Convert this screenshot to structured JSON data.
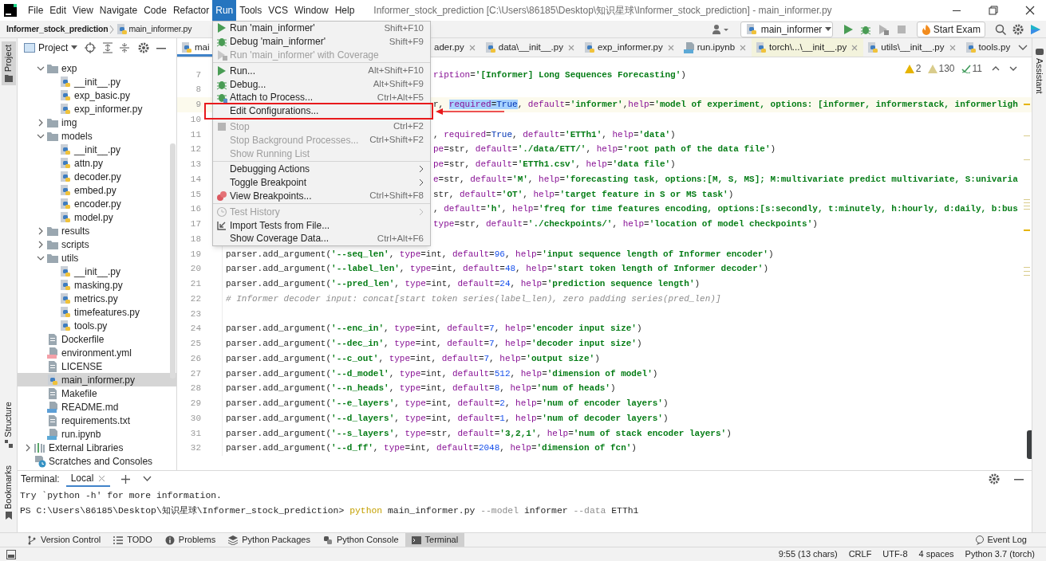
{
  "window": {
    "title": "Informer_stock_prediction [C:\\Users\\86185\\Desktop\\知识星球\\Informer_stock_prediction] - main_informer.py"
  },
  "menu_bar": [
    {
      "label": "File",
      "selected": false
    },
    {
      "label": "Edit",
      "selected": false
    },
    {
      "label": "View",
      "selected": false
    },
    {
      "label": "Navigate",
      "selected": false
    },
    {
      "label": "Code",
      "selected": false
    },
    {
      "label": "Refactor",
      "selected": false
    },
    {
      "label": "Run",
      "selected": true
    },
    {
      "label": "Tools",
      "selected": false
    },
    {
      "label": "VCS",
      "selected": false
    },
    {
      "label": "Window",
      "selected": false
    },
    {
      "label": "Help",
      "selected": false
    }
  ],
  "breadcrumb": {
    "project": "Informer_stock_prediction",
    "file": "main_informer.py"
  },
  "toolbar": {
    "run_config": "main_informer",
    "exam_button": "Start Exam"
  },
  "side_tools": {
    "project": {
      "label": "Project",
      "selected": true
    },
    "structure": {
      "label": "Structure",
      "selected": false
    },
    "bookmarks": {
      "label": "Bookmarks",
      "selected": false
    },
    "assistant": {
      "label": "Assistant",
      "selected": false
    }
  },
  "project_panel": {
    "title": "Project",
    "project_contents": [
      {
        "label": "exp",
        "kind": "folder",
        "expanded": true,
        "selected": false,
        "children": [
          {
            "label": "__init__.py",
            "kind": "python",
            "selected": false
          },
          {
            "label": "exp_basic.py",
            "kind": "python",
            "selected": false
          },
          {
            "label": "exp_informer.py",
            "kind": "python",
            "selected": false
          }
        ]
      },
      {
        "label": "img",
        "kind": "folder",
        "expanded": false,
        "selected": false
      },
      {
        "label": "models",
        "kind": "folder",
        "expanded": true,
        "selected": false,
        "children": [
          {
            "label": "__init__.py",
            "kind": "python",
            "selected": false
          },
          {
            "label": "attn.py",
            "kind": "python",
            "selected": false
          },
          {
            "label": "decoder.py",
            "kind": "python",
            "selected": false
          },
          {
            "label": "embed.py",
            "kind": "python",
            "selected": false
          },
          {
            "label": "encoder.py",
            "kind": "python",
            "selected": false
          },
          {
            "label": "model.py",
            "kind": "python",
            "selected": false
          }
        ]
      },
      {
        "label": "results",
        "kind": "folder",
        "expanded": false,
        "selected": false
      },
      {
        "label": "scripts",
        "kind": "folder",
        "expanded": false,
        "selected": false
      },
      {
        "label": "utils",
        "kind": "folder",
        "expanded": true,
        "selected": false,
        "children": [
          {
            "label": "__init__.py",
            "kind": "python",
            "selected": false
          },
          {
            "label": "masking.py",
            "kind": "python",
            "selected": false
          },
          {
            "label": "metrics.py",
            "kind": "python",
            "selected": false
          },
          {
            "label": "timefeatures.py",
            "kind": "python",
            "selected": false
          },
          {
            "label": "tools.py",
            "kind": "python",
            "selected": false
          }
        ]
      },
      {
        "label": "Dockerfile",
        "kind": "file",
        "selected": false
      },
      {
        "label": "environment.yml",
        "kind": "yml",
        "selected": false
      },
      {
        "label": "LICENSE",
        "kind": "file",
        "selected": false
      },
      {
        "label": "main_informer.py",
        "kind": "python",
        "selected": true
      },
      {
        "label": "Makefile",
        "kind": "file",
        "selected": false
      },
      {
        "label": "README.md",
        "kind": "md",
        "selected": false
      },
      {
        "label": "requirements.txt",
        "kind": "file",
        "selected": false
      },
      {
        "label": "run.ipynb",
        "kind": "ipynb",
        "selected": false
      }
    ],
    "roots": [
      {
        "label": "External Libraries",
        "kind": "libraries",
        "expanded": false,
        "selected": false
      },
      {
        "label": "Scratches and Consoles",
        "kind": "scratches",
        "selected": false
      }
    ]
  },
  "editor": {
    "tabs": [
      {
        "label": "mai",
        "kind": "python",
        "selected": true,
        "closable": false,
        "external": false
      },
      {
        "label": "ader.py",
        "kind": "plain",
        "selected": false,
        "closable": true,
        "external": false
      },
      {
        "label": "data\\__init__.py",
        "kind": "python",
        "selected": false,
        "closable": true,
        "external": false
      },
      {
        "label": "exp_informer.py",
        "kind": "python",
        "selected": false,
        "closable": true,
        "external": false
      },
      {
        "label": "run.ipynb",
        "kind": "notebook",
        "selected": false,
        "closable": true,
        "external": false
      },
      {
        "label": "torch\\...\\__init__.py",
        "kind": "python",
        "selected": false,
        "closable": true,
        "external": true
      },
      {
        "label": "utils\\__init__.py",
        "kind": "python",
        "selected": false,
        "closable": true,
        "external": false
      },
      {
        "label": "tools.py",
        "kind": "python",
        "selected": false,
        "closable": false,
        "external": false
      }
    ],
    "inspections": {
      "warnings": "2",
      "weak_warnings": "130",
      "typos": "11"
    },
    "code_lines": [
      {
        "number": "7",
        "current": false,
        "parts": [
          {
            "text": "ription='[Informer] Long Sequences Forecasting')",
            "selected": false
          }
        ]
      },
      {
        "number": "8",
        "current": false
      },
      {
        "number": "9",
        "current": true,
        "parts": [
          {
            "text": "r, ",
            "selected": false
          },
          {
            "text": "required=True",
            "selected": true
          },
          {
            "text": ", default='informer',help='model of experiment, options: [informer, informerstack, informerligh",
            "selected": false
          }
        ]
      },
      {
        "number": "10",
        "current": false
      },
      {
        "number": "11",
        "current": false,
        "parts": [
          {
            "text": ", required=True, default='ETTh1', help='data')",
            "selected": false
          }
        ]
      },
      {
        "number": "12",
        "current": false,
        "parts": [
          {
            "text": "pe=str, default='./data/ETT/', help='root path of the data file')",
            "selected": false
          }
        ]
      },
      {
        "number": "13",
        "current": false,
        "parts": [
          {
            "text": "pe=str, default='ETTh1.csv', help='data file')",
            "selected": false
          }
        ]
      },
      {
        "number": "14",
        "current": false,
        "parts": [
          {
            "text": "e=str, default='M', help='forecasting task, options:[M, S, MS]; M:multivariate predict multivariate, S:univaria",
            "selected": false
          }
        ]
      },
      {
        "number": "15",
        "current": false,
        "parts": [
          {
            "text": "str, default='OT', help='target feature in S or MS task')",
            "selected": false
          }
        ]
      },
      {
        "number": "16",
        "current": false,
        "parts": [
          {
            "text": ", default='h', help='freq for time features encoding, options:[s:secondly, t:minutely, h:hourly, d:daily, b:bus",
            "selected": false
          }
        ]
      },
      {
        "number": "17",
        "current": false,
        "parts": [
          {
            "text": "type=str, default='./checkpoints/', help='location of model checkpoints')",
            "selected": false
          }
        ]
      },
      {
        "number": "18",
        "current": false
      },
      {
        "number": "19",
        "current": false,
        "parts": [
          {
            "text": "parser.add_argument('--seq_len', type=int, default=96, help='input sequence length of Informer encoder')",
            "selected": false
          }
        ]
      },
      {
        "number": "20",
        "current": false,
        "parts": [
          {
            "text": "parser.add_argument('--label_len', type=int, default=48, help='start token length of Informer decoder')",
            "selected": false
          }
        ]
      },
      {
        "number": "21",
        "current": false,
        "parts": [
          {
            "text": "parser.add_argument('--pred_len', type=int, default=24, help='prediction sequence length')",
            "selected": false
          }
        ]
      },
      {
        "number": "22",
        "current": false,
        "parts": [
          {
            "text": "# Informer decoder input: concat[start token series(label_len), zero padding series(pred_len)]",
            "selected": false
          }
        ]
      },
      {
        "number": "23",
        "current": false
      },
      {
        "number": "24",
        "current": false,
        "parts": [
          {
            "text": "parser.add_argument('--enc_in', type=int, default=7, help='encoder input size')",
            "selected": false
          }
        ]
      },
      {
        "number": "25",
        "current": false,
        "parts": [
          {
            "text": "parser.add_argument('--dec_in', type=int, default=7, help='decoder input size')",
            "selected": false
          }
        ]
      },
      {
        "number": "26",
        "current": false,
        "parts": [
          {
            "text": "parser.add_argument('--c_out', type=int, default=7, help='output size')",
            "selected": false
          }
        ]
      },
      {
        "number": "27",
        "current": false,
        "parts": [
          {
            "text": "parser.add_argument('--d_model', type=int, default=512, help='dimension of model')",
            "selected": false
          }
        ]
      },
      {
        "number": "28",
        "current": false,
        "parts": [
          {
            "text": "parser.add_argument('--n_heads', type=int, default=8, help='num of heads')",
            "selected": false
          }
        ]
      },
      {
        "number": "29",
        "current": false,
        "parts": [
          {
            "text": "parser.add_argument('--e_layers', type=int, default=2, help='num of encoder layers')",
            "selected": false
          }
        ]
      },
      {
        "number": "30",
        "current": false,
        "parts": [
          {
            "text": "parser.add_argument('--d_layers', type=int, default=1, help='num of decoder layers')",
            "selected": false
          }
        ]
      },
      {
        "number": "31",
        "current": false,
        "parts": [
          {
            "text": "parser.add_argument('--s_layers', type=str, default='3,2,1', help='num of stack encoder layers')",
            "selected": false
          }
        ]
      },
      {
        "number": "32",
        "current": false,
        "parts": [
          {
            "text": "parser.add_argument('--d_ff', type=int, default=2048, help='dimension of fcn')",
            "selected": false
          }
        ]
      }
    ]
  },
  "run_menu": {
    "items": [
      {
        "kind": "item",
        "label": "Run 'main_informer'",
        "shortcut": "Shift+F10",
        "disabled": false,
        "submenu": false,
        "annotated": false
      },
      {
        "kind": "item",
        "label": "Debug 'main_informer'",
        "shortcut": "Shift+F9",
        "disabled": false,
        "submenu": false,
        "annotated": false
      },
      {
        "kind": "item",
        "label": "Run 'main_informer' with Coverage",
        "disabled": true,
        "submenu": false,
        "annotated": false
      },
      {
        "kind": "separator"
      },
      {
        "kind": "item",
        "label": "Run...",
        "shortcut": "Alt+Shift+F10",
        "disabled": false,
        "submenu": false,
        "annotated": false
      },
      {
        "kind": "item",
        "label": "Debug...",
        "shortcut": "Alt+Shift+F9",
        "disabled": false,
        "submenu": false,
        "annotated": false
      },
      {
        "kind": "item",
        "label": "Attach to Process...",
        "shortcut": "Ctrl+Alt+F5",
        "disabled": false,
        "submenu": false,
        "annotated": false
      },
      {
        "kind": "item",
        "label": "Edit Configurations...",
        "disabled": false,
        "submenu": false,
        "annotated": true
      },
      {
        "kind": "separator"
      },
      {
        "kind": "item",
        "label": "Stop",
        "shortcut": "Ctrl+F2",
        "disabled": true,
        "submenu": false,
        "annotated": false
      },
      {
        "kind": "item",
        "label": "Stop Background Processes...",
        "shortcut": "Ctrl+Shift+F2",
        "disabled": true,
        "submenu": false,
        "annotated": false
      },
      {
        "kind": "item",
        "label": "Show Running List",
        "disabled": true,
        "submenu": false,
        "annotated": false
      },
      {
        "kind": "separator"
      },
      {
        "kind": "item",
        "label": "Debugging Actions",
        "disabled": false,
        "submenu": true,
        "annotated": false
      },
      {
        "kind": "item",
        "label": "Toggle Breakpoint",
        "disabled": false,
        "submenu": true,
        "annotated": false
      },
      {
        "kind": "item",
        "label": "View Breakpoints...",
        "shortcut": "Ctrl+Shift+F8",
        "disabled": false,
        "submenu": false,
        "annotated": false
      },
      {
        "kind": "separator"
      },
      {
        "kind": "item",
        "label": "Test History",
        "disabled": true,
        "submenu": true,
        "annotated": false
      },
      {
        "kind": "item",
        "label": "Import Tests from File...",
        "disabled": false,
        "submenu": false,
        "annotated": false
      },
      {
        "kind": "item",
        "label": "Show Coverage Data...",
        "shortcut": "Ctrl+Alt+F6",
        "disabled": false,
        "submenu": false,
        "annotated": false
      }
    ]
  },
  "terminal": {
    "title": "Terminal:",
    "tabs": [
      {
        "label": "Local",
        "selected": true
      }
    ],
    "lines": [
      {
        "parts": [
          {
            "kind": "output",
            "text": "Try `python -h' for more information."
          }
        ]
      },
      {
        "parts": [
          {
            "kind": "output",
            "text": "PS C:\\Users\\86185\\Desktop\\知识星球\\Informer_stock_prediction> "
          },
          {
            "kind": "command",
            "text": "python"
          },
          {
            "kind": "output",
            "text": " main_informer.py "
          },
          {
            "kind": "option",
            "text": "--model"
          },
          {
            "kind": "output",
            "text": " informer "
          },
          {
            "kind": "option",
            "text": "--data"
          },
          {
            "kind": "output",
            "text": " ETTh1"
          }
        ]
      }
    ]
  },
  "tool_windows": [
    {
      "label": "Version Control",
      "kind": "branch",
      "selected": false
    },
    {
      "label": "TODO",
      "kind": "list",
      "selected": false
    },
    {
      "label": "Problems",
      "kind": "info",
      "selected": false
    },
    {
      "label": "Python Packages",
      "kind": "packages",
      "selected": false
    },
    {
      "label": "Python Console",
      "kind": "python",
      "selected": false
    },
    {
      "label": "Terminal",
      "kind": "terminal",
      "selected": true
    }
  ],
  "event_log": "Event Log",
  "status_bar": [
    "9:55 (13 chars)",
    "CRLF",
    "UTF-8",
    "4 spaces",
    "Python 3.7 (torch)"
  ]
}
